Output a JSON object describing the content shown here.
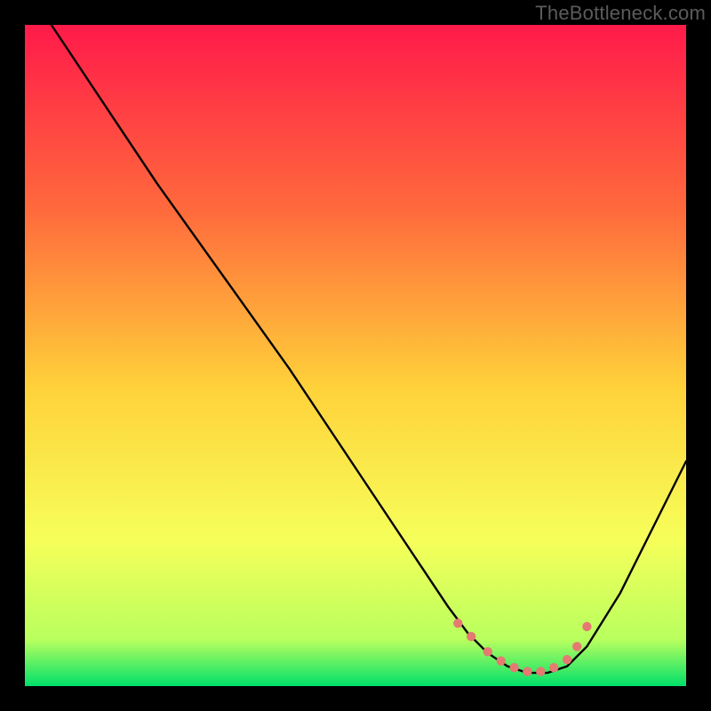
{
  "watermark": "TheBottleneck.com",
  "gradient": {
    "top": "#ff1a4a",
    "q1": "#ff6a3c",
    "mid": "#ffd23a",
    "q3": "#f6ff5a",
    "q4": "#b8ff5e",
    "bottom": "#00e06a"
  },
  "chart_data": {
    "type": "line",
    "title": "",
    "xlabel": "",
    "ylabel": "",
    "xlim": [
      0,
      100
    ],
    "ylim": [
      0,
      100
    ],
    "grid": false,
    "legend": false,
    "series": [
      {
        "name": "bottleneck-curve",
        "x": [
          4,
          10,
          20,
          30,
          40,
          50,
          60,
          64,
          67,
          70,
          73,
          76,
          79,
          82,
          85,
          90,
          100
        ],
        "y": [
          100,
          91,
          76,
          62,
          48,
          33,
          18,
          12,
          8,
          5,
          3,
          2,
          2,
          3,
          6,
          14,
          34
        ]
      }
    ],
    "markers": {
      "name": "highlight-dots",
      "x": [
        65.5,
        67.5,
        70,
        72,
        74,
        76,
        78,
        80,
        82,
        83.5,
        85
      ],
      "y": [
        9.5,
        7.5,
        5.2,
        3.8,
        2.8,
        2.2,
        2.2,
        2.8,
        4.0,
        6.0,
        9.0
      ]
    }
  }
}
